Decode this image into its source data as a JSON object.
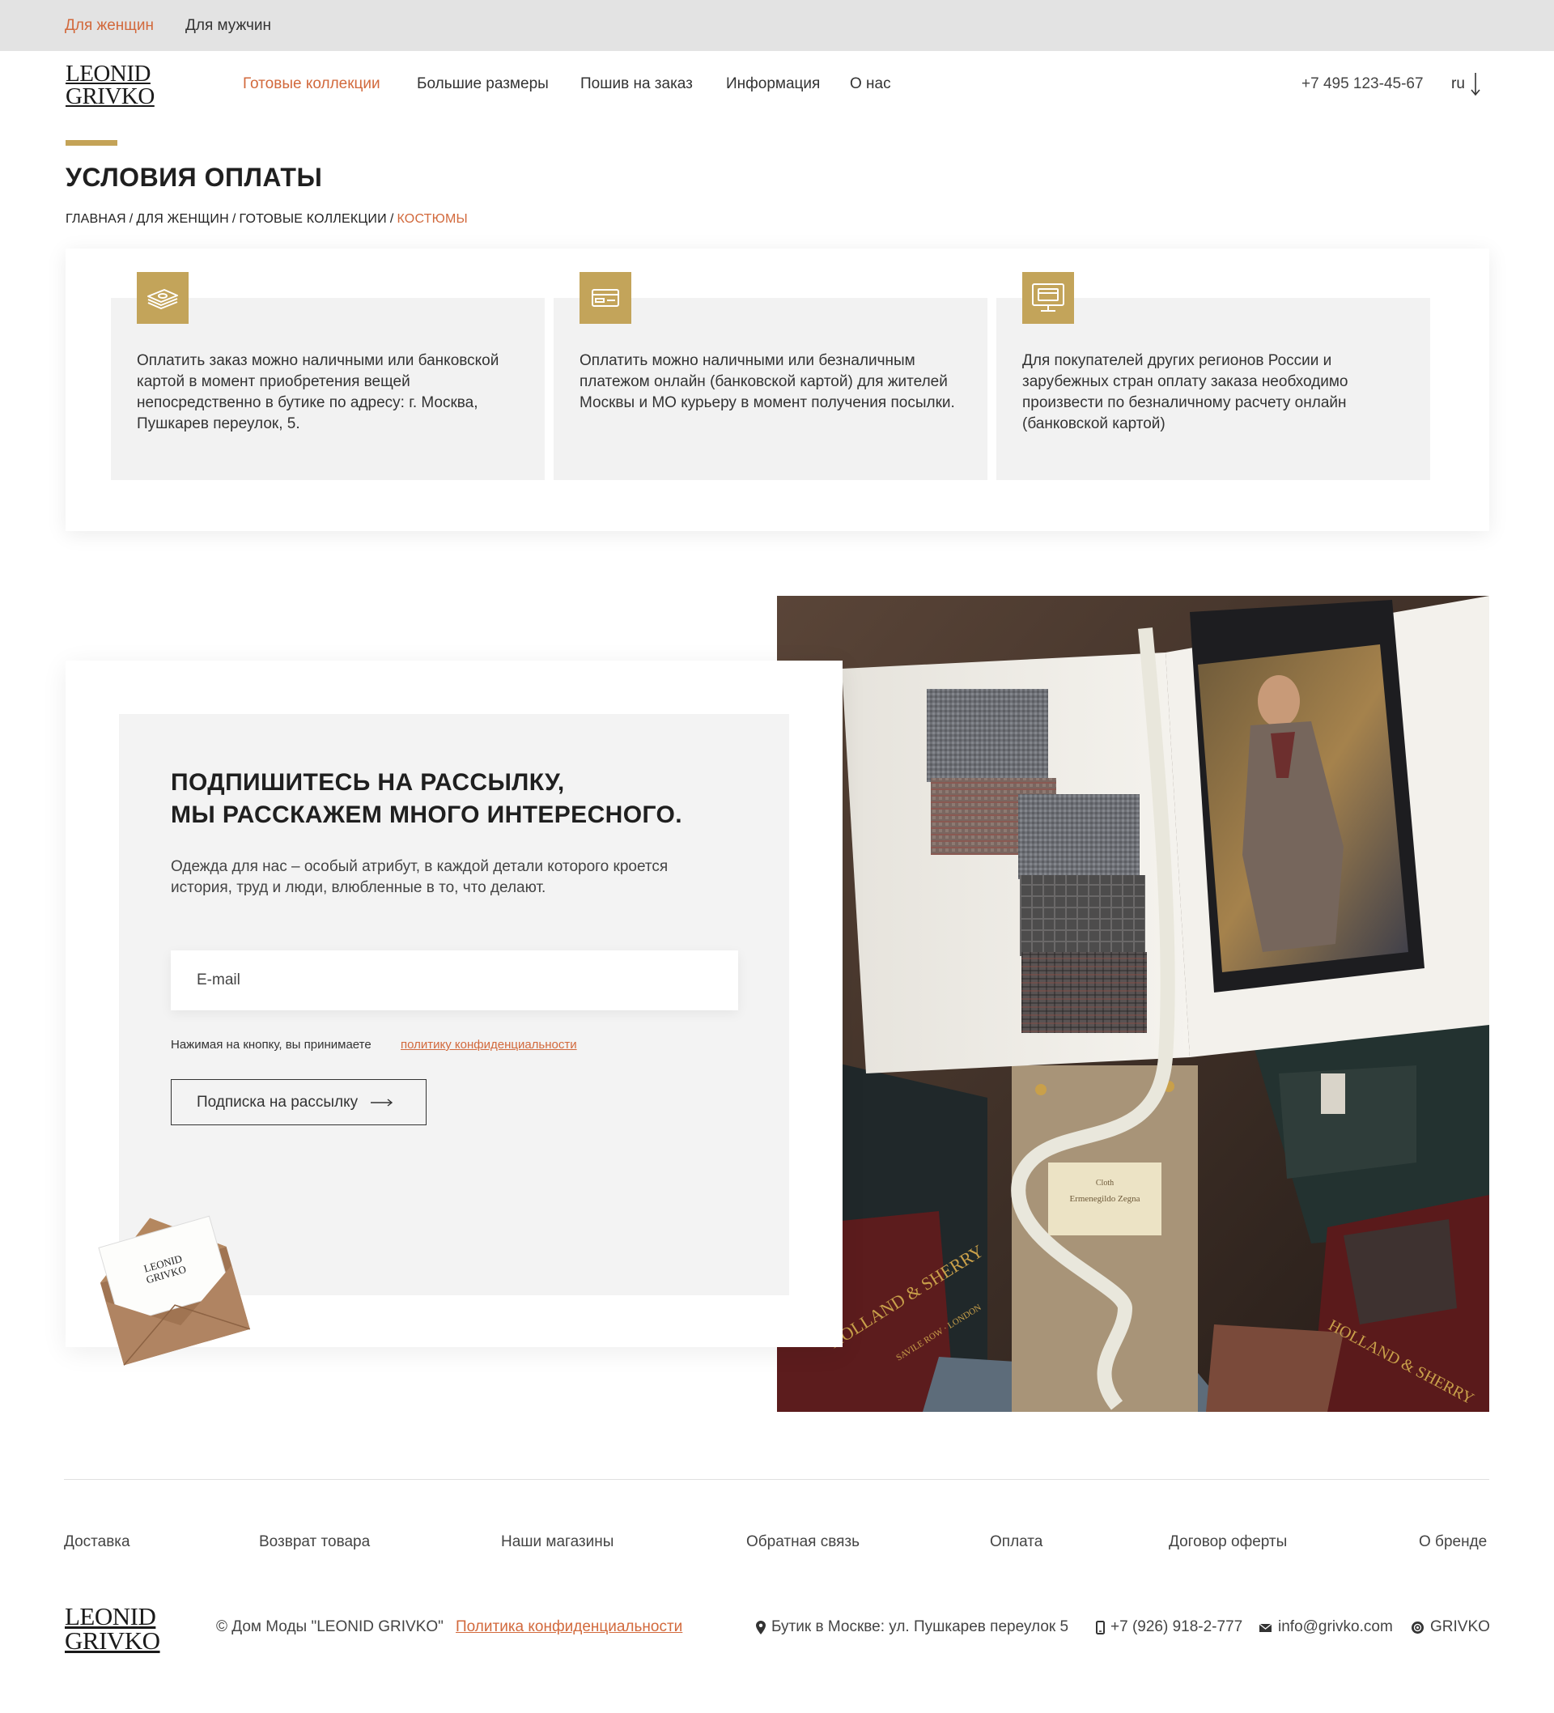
{
  "topbar": {
    "women": "Для женщин",
    "men": "Для мужчин"
  },
  "header": {
    "logo_line1": "LEONID",
    "logo_line2": "GRIVKO",
    "nav": [
      "Готовые коллекции",
      "Большие размеры",
      "Пошив на заказ",
      "Информация",
      "О нас"
    ],
    "phone": "+7 495 123-45-67",
    "lang": "ru"
  },
  "page": {
    "title": "УСЛОВИЯ ОПЛАТЫ",
    "breadcrumbs": [
      "ГЛАВНАЯ",
      "ДЛЯ ЖЕНЩИН",
      "ГОТОВЫЕ КОЛЛЕКЦИИ",
      "КОСТЮМЫ"
    ],
    "breadcrumb_sep": "/"
  },
  "payment": [
    {
      "icon": "cash-icon",
      "text": "Оплатить заказ можно наличными или банковской картой в момент приобретения вещей непосредственно в бутике по адресу: г. Москва, Пушкарев переулок, 5."
    },
    {
      "icon": "card-icon",
      "text": "Оплатить можно наличными или безналичным платежом онлайн (банковской картой) для жителей Москвы и МО курьеру в момент получения посылки."
    },
    {
      "icon": "online-payment-icon",
      "text": "Для покупателей других регионов России и зарубежных стран оплату заказа необходимо произвести по безналичному расчету онлайн (банковской картой)"
    }
  ],
  "subscribe": {
    "title_line1": "ПОДПИШИТЕСЬ НА РАССЫЛКУ,",
    "title_line2": "МЫ РАССКАЖЕМ МНОГО ИНТЕРЕСНОГО.",
    "description": "Одежда для нас – особый атрибут, в каждой детали которого кроется история, труд и люди, влюбленные в то, что делают.",
    "email_placeholder": "E-mail",
    "agree_text": "Нажимая на кнопку, вы принимаете",
    "agree_link": "политику конфиденциальности",
    "button": "Подписка на рассылку",
    "envelope_logo_line1": "LEONID",
    "envelope_logo_line2": "GRIVKO",
    "photo_texts": {
      "label": "Cloth",
      "brand": "Ermenegildo Zegna",
      "box_brand": "HOLLAND & SHERRY",
      "box_sub": "SAVILE ROW · LONDON"
    }
  },
  "footer": {
    "nav": [
      "Доставка",
      "Возврат товара",
      "Наши магазины",
      "Обратная связь",
      "Оплата",
      "Договор оферты",
      "О бренде"
    ],
    "logo_line1": "LEONID",
    "logo_line2": "GRIVKO",
    "copyright": "© Дом Моды \"LEONID GRIVKO\"",
    "policy": "Политика конфиденциальности",
    "address": "Бутик в Москве: ул. Пушкарев переулок 5",
    "phone": "+7 (926) 918-2-777",
    "email": "info@grivko.com",
    "social": "GRIVKO"
  },
  "colors": {
    "accent": "#d2693c",
    "gold": "#c3a45a",
    "topbar": "#e3e3e3"
  }
}
